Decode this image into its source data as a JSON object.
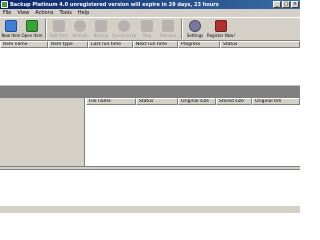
{
  "window": {
    "title": "Backup Platinum 4.0 unregistered version will expire in 29 days, 23 hours",
    "controls": [
      "_",
      "□",
      "×"
    ]
  },
  "menu": [
    "File",
    "View",
    "Actions",
    "Tools",
    "Help"
  ],
  "toolbar": {
    "buttons": [
      {
        "label": "New Item",
        "icon": "new-item-icon",
        "enabled": true,
        "color": "#3f7fd6"
      },
      {
        "label": "Open Item",
        "icon": "open-item-icon",
        "enabled": true,
        "color": "#39a23a"
      },
      {
        "label": "Edit Item",
        "icon": "edit-item-icon",
        "enabled": false,
        "color": "#808080"
      },
      {
        "label": "Refresh",
        "icon": "refresh-icon",
        "enabled": false,
        "color": "#808080"
      },
      {
        "label": "Backup",
        "icon": "backup-icon",
        "enabled": false,
        "color": "#808080"
      },
      {
        "label": "Synchronize",
        "icon": "synchronize-icon",
        "enabled": false,
        "color": "#808080"
      },
      {
        "label": "Stop",
        "icon": "stop-icon",
        "enabled": false,
        "color": "#808080"
      },
      {
        "label": "Remove",
        "icon": "remove-icon",
        "enabled": false,
        "color": "#808080"
      },
      {
        "label": "Settings",
        "icon": "settings-icon",
        "enabled": true,
        "color": "#7a7a9a"
      },
      {
        "label": "Register Now!",
        "icon": "register-icon",
        "enabled": true,
        "color": "#b03030"
      }
    ]
  },
  "top_table": {
    "columns": [
      "Item name",
      "Item type",
      "Last run time",
      "Next run time",
      "Progress",
      "Status"
    ]
  },
  "file_table": {
    "columns": [
      "File name",
      "Status",
      "Original size",
      "Stored size",
      "Original tim"
    ]
  }
}
